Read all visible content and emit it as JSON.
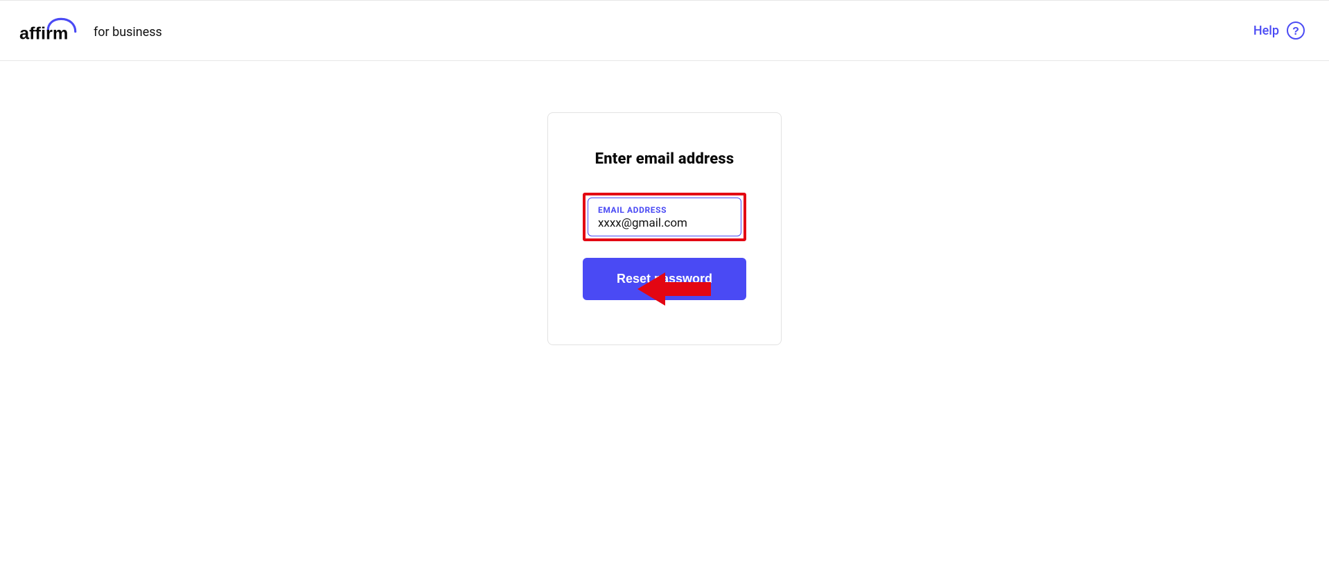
{
  "header": {
    "logo_text": "affirm",
    "logo_sub": "for business",
    "help_label": "Help"
  },
  "card": {
    "title": "Enter email address",
    "email_label": "EMAIL ADDRESS",
    "email_value": "xxxx@gmail.com",
    "button_label": "Reset password"
  },
  "colors": {
    "brand": "#4A4AF4",
    "highlight": "#e30613"
  }
}
